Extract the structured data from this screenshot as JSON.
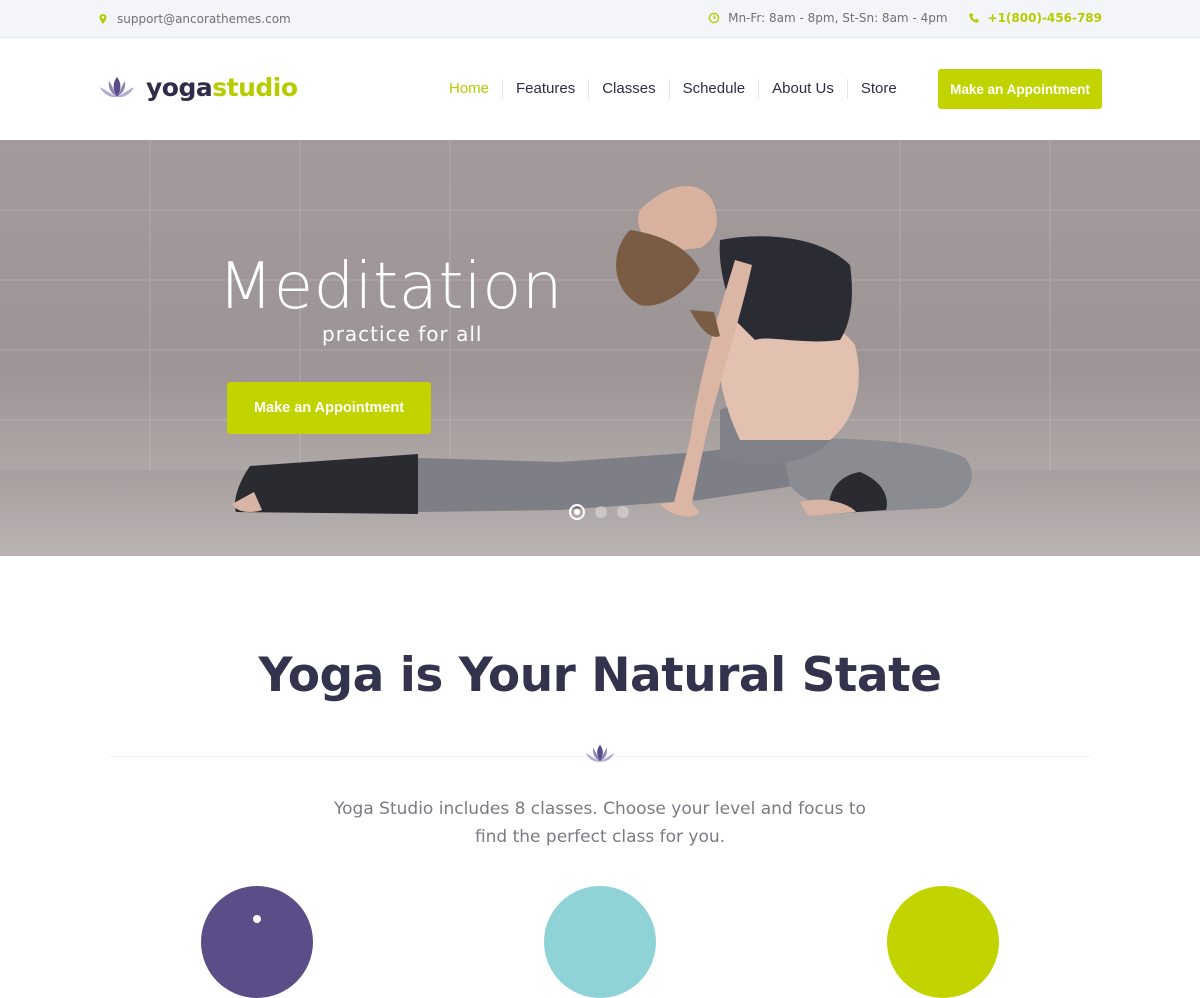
{
  "topbar": {
    "email": "support@ancorathemes.com",
    "hours": "Mn-Fr: 8am - 8pm, St-Sn: 8am - 4pm",
    "phone": "+1(800)-456-789",
    "icons": {
      "email": "map-pin-icon",
      "hours": "clock-icon",
      "phone": "phone-icon"
    }
  },
  "header": {
    "logo_part1": "yoga",
    "logo_part2": "studio",
    "nav": [
      {
        "label": "Home",
        "active": true
      },
      {
        "label": "Features"
      },
      {
        "label": "Classes"
      },
      {
        "label": "Schedule"
      },
      {
        "label": "About Us"
      },
      {
        "label": "Store"
      }
    ],
    "cta_label": "Make an Appointment"
  },
  "hero": {
    "title": "Meditation",
    "subtitle": "practice for all",
    "cta_label": "Make an Appointment",
    "slides_total": 3,
    "active_slide": 1
  },
  "intro": {
    "title": "Yoga is Your Natural State",
    "text": "Yoga Studio includes 8 classes. Choose your level and focus to find the perfect class for you."
  },
  "colors": {
    "accent": "#c2d400",
    "accent_text": "#b6cc00",
    "purple": "#5a4d88",
    "teal": "#8fd3d7",
    "dark": "#2e2d4a"
  }
}
